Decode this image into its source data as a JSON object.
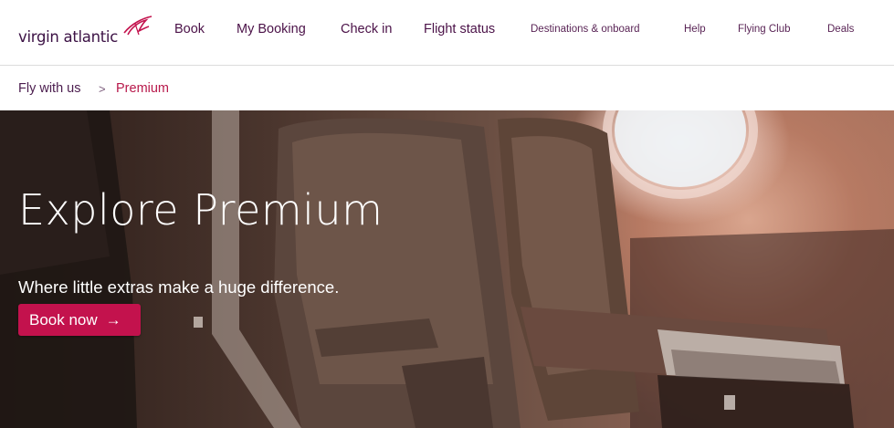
{
  "brand": {
    "name": "virgin atlantic",
    "mark": "Virgin"
  },
  "nav": {
    "items": [
      {
        "label": "Book"
      },
      {
        "label": "My Booking"
      },
      {
        "label": "Check in"
      },
      {
        "label": "Flight status"
      },
      {
        "label": "Destinations & onboard"
      },
      {
        "label": "Help"
      },
      {
        "label": "Flying Club"
      },
      {
        "label": "Deals"
      }
    ]
  },
  "breadcrumb": {
    "parent": "Fly with us",
    "separator": ">",
    "current": "Premium"
  },
  "hero": {
    "title": "Explore Premium",
    "subtitle": "Where little extras make a huge difference.",
    "button_label": "Book now",
    "button_arrow": "→"
  },
  "colors": {
    "brand_purple": "#4b1248",
    "accent_red": "#c3124d",
    "breadcrumb_current": "#b8194b"
  },
  "icons": {
    "logo": "virgin-signature-icon",
    "button": "arrow-right-icon"
  }
}
